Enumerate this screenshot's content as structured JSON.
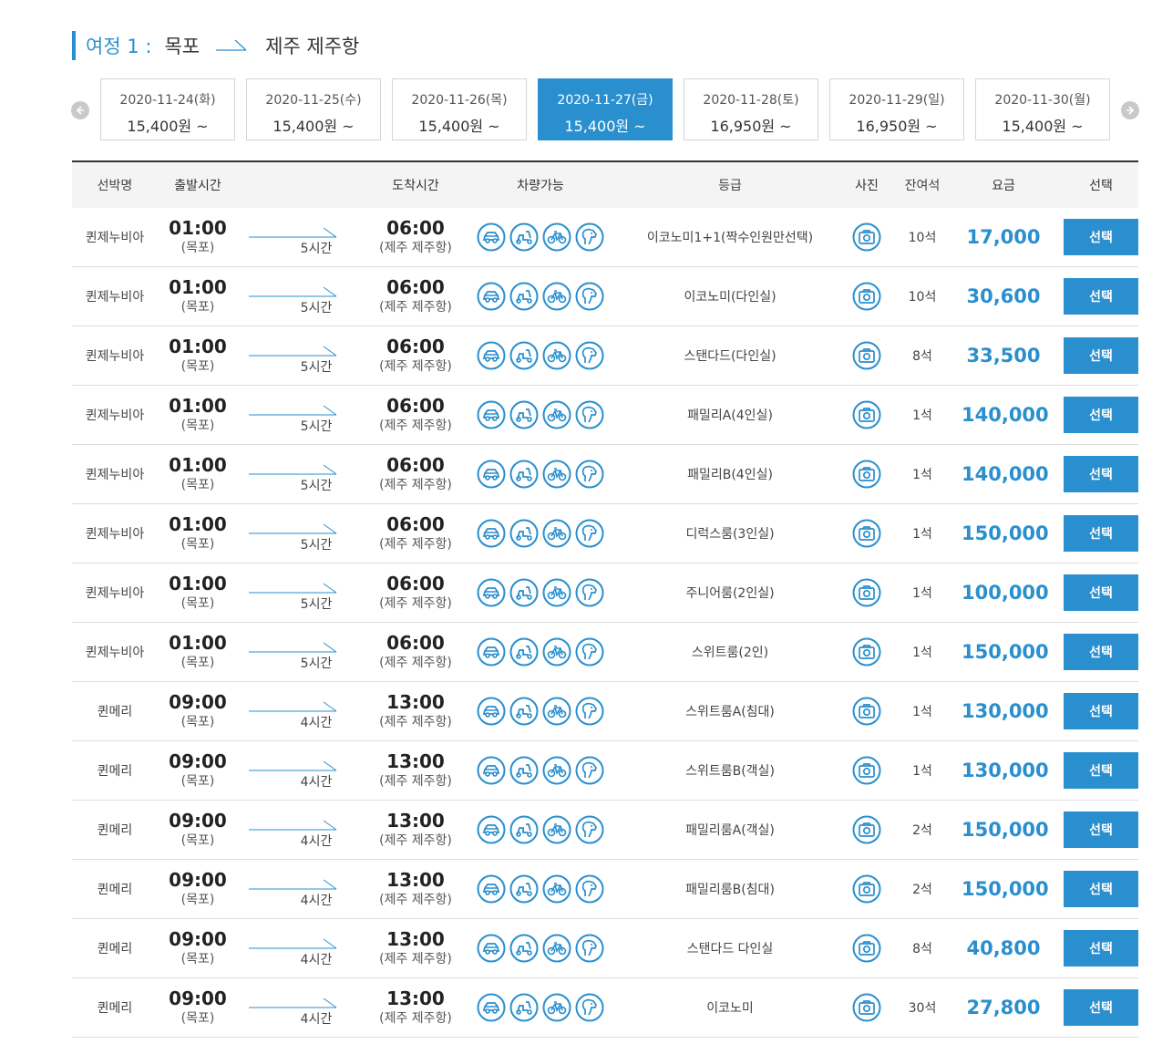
{
  "trip": {
    "label": "여정 1 :",
    "from": "목포",
    "to": "제주 제주항"
  },
  "dates": [
    {
      "date": "2020-11-24(화)",
      "price": "15,400원 ~",
      "active": false
    },
    {
      "date": "2020-11-25(수)",
      "price": "15,400원 ~",
      "active": false
    },
    {
      "date": "2020-11-26(목)",
      "price": "15,400원 ~",
      "active": false
    },
    {
      "date": "2020-11-27(금)",
      "price": "15,400원 ~",
      "active": true
    },
    {
      "date": "2020-11-28(토)",
      "price": "16,950원 ~",
      "active": false
    },
    {
      "date": "2020-11-29(일)",
      "price": "16,950원 ~",
      "active": false
    },
    {
      "date": "2020-11-30(월)",
      "price": "15,400원 ~",
      "active": false
    }
  ],
  "headers": {
    "ship": "선박명",
    "dep": "출발시간",
    "arr": "도착시간",
    "car": "차량가능",
    "grade": "등급",
    "photo": "사진",
    "seat": "잔여석",
    "price": "요금",
    "select": "선택"
  },
  "icons": [
    "car-icon",
    "motorcycle-icon",
    "bicycle-icon",
    "pet-icon"
  ],
  "accent": "#2a8fce",
  "rows": [
    {
      "ship": "퀸제누비아",
      "dep": "01:00",
      "dep_port": "(목포)",
      "duration": "5시간",
      "arr": "06:00",
      "arr_port": "(제주 제주항)",
      "grade": "이코노미1+1(짝수인원만선택)",
      "seats": "10석",
      "price": "17,000",
      "select": "선택"
    },
    {
      "ship": "퀸제누비아",
      "dep": "01:00",
      "dep_port": "(목포)",
      "duration": "5시간",
      "arr": "06:00",
      "arr_port": "(제주 제주항)",
      "grade": "이코노미(다인실)",
      "seats": "10석",
      "price": "30,600",
      "select": "선택"
    },
    {
      "ship": "퀸제누비아",
      "dep": "01:00",
      "dep_port": "(목포)",
      "duration": "5시간",
      "arr": "06:00",
      "arr_port": "(제주 제주항)",
      "grade": "스탠다드(다인실)",
      "seats": "8석",
      "price": "33,500",
      "select": "선택"
    },
    {
      "ship": "퀸제누비아",
      "dep": "01:00",
      "dep_port": "(목포)",
      "duration": "5시간",
      "arr": "06:00",
      "arr_port": "(제주 제주항)",
      "grade": "패밀리A(4인실)",
      "seats": "1석",
      "price": "140,000",
      "select": "선택"
    },
    {
      "ship": "퀸제누비아",
      "dep": "01:00",
      "dep_port": "(목포)",
      "duration": "5시간",
      "arr": "06:00",
      "arr_port": "(제주 제주항)",
      "grade": "패밀리B(4인실)",
      "seats": "1석",
      "price": "140,000",
      "select": "선택"
    },
    {
      "ship": "퀸제누비아",
      "dep": "01:00",
      "dep_port": "(목포)",
      "duration": "5시간",
      "arr": "06:00",
      "arr_port": "(제주 제주항)",
      "grade": "디럭스룸(3인실)",
      "seats": "1석",
      "price": "150,000",
      "select": "선택"
    },
    {
      "ship": "퀸제누비아",
      "dep": "01:00",
      "dep_port": "(목포)",
      "duration": "5시간",
      "arr": "06:00",
      "arr_port": "(제주 제주항)",
      "grade": "주니어룸(2인실)",
      "seats": "1석",
      "price": "100,000",
      "select": "선택"
    },
    {
      "ship": "퀸제누비아",
      "dep": "01:00",
      "dep_port": "(목포)",
      "duration": "5시간",
      "arr": "06:00",
      "arr_port": "(제주 제주항)",
      "grade": "스위트룸(2인)",
      "seats": "1석",
      "price": "150,000",
      "select": "선택"
    },
    {
      "ship": "퀸메리",
      "dep": "09:00",
      "dep_port": "(목포)",
      "duration": "4시간",
      "arr": "13:00",
      "arr_port": "(제주 제주항)",
      "grade": "스위트룸A(침대)",
      "seats": "1석",
      "price": "130,000",
      "select": "선택"
    },
    {
      "ship": "퀸메리",
      "dep": "09:00",
      "dep_port": "(목포)",
      "duration": "4시간",
      "arr": "13:00",
      "arr_port": "(제주 제주항)",
      "grade": "스위트룸B(객실)",
      "seats": "1석",
      "price": "130,000",
      "select": "선택"
    },
    {
      "ship": "퀸메리",
      "dep": "09:00",
      "dep_port": "(목포)",
      "duration": "4시간",
      "arr": "13:00",
      "arr_port": "(제주 제주항)",
      "grade": "패밀리룸A(객실)",
      "seats": "2석",
      "price": "150,000",
      "select": "선택"
    },
    {
      "ship": "퀸메리",
      "dep": "09:00",
      "dep_port": "(목포)",
      "duration": "4시간",
      "arr": "13:00",
      "arr_port": "(제주 제주항)",
      "grade": "패밀리룸B(침대)",
      "seats": "2석",
      "price": "150,000",
      "select": "선택"
    },
    {
      "ship": "퀸메리",
      "dep": "09:00",
      "dep_port": "(목포)",
      "duration": "4시간",
      "arr": "13:00",
      "arr_port": "(제주 제주항)",
      "grade": "스탠다드 다인실",
      "seats": "8석",
      "price": "40,800",
      "select": "선택"
    },
    {
      "ship": "퀸메리",
      "dep": "09:00",
      "dep_port": "(목포)",
      "duration": "4시간",
      "arr": "13:00",
      "arr_port": "(제주 제주항)",
      "grade": "이코노미",
      "seats": "30석",
      "price": "27,800",
      "select": "선택"
    }
  ]
}
